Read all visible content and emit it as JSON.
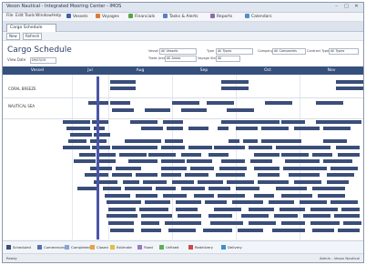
{
  "window": {
    "title": "Veson Nautical - Integrated Mooring Center - IMOS"
  },
  "menu": [
    "File",
    "Edit",
    "Tools",
    "Window",
    "Help"
  ],
  "toolbar": [
    {
      "label": "Vessels",
      "icon": "ship-icon",
      "color": "#3a64a8"
    },
    {
      "label": "Voyages",
      "icon": "route-icon",
      "color": "#e07a2f"
    },
    {
      "label": "Financials",
      "icon": "chart-icon",
      "color": "#58a24b"
    },
    {
      "label": "Tasks & Alerts",
      "icon": "bell-icon",
      "color": "#5a7ec9"
    },
    {
      "label": "Reports",
      "icon": "report-icon",
      "color": "#8d6ab2"
    },
    {
      "label": "Calendars",
      "icon": "calendar-icon",
      "color": "#4f8fcc"
    }
  ],
  "tab": {
    "label": "Cargo Schedule"
  },
  "subbar": {
    "new_label": "New",
    "refresh_label": "Refresh"
  },
  "header": {
    "title": "Cargo Schedule",
    "view_date_label": "View Date",
    "view_date_value": "09/03/19"
  },
  "filters": {
    "vessel_label": "Vessel",
    "vessel_value": "All Vessels",
    "type_label": "Type",
    "type_value": "All Types",
    "company_label": "Company",
    "company_value": "All Companies",
    "contract_type_label": "Contract Type",
    "contract_type_value": "All Types",
    "trade_area_label": "Trade Area",
    "trade_area_value": "All Areas",
    "status_label": "Voyage Status",
    "status_value": "All"
  },
  "grid": {
    "columns": [
      "Vessel",
      "Jul",
      "Aug",
      "Sep",
      "Oct",
      "Nov"
    ],
    "rows": [
      "CORAL BREEZE",
      "NAUTICAL SEA"
    ]
  },
  "legend": [
    {
      "label": "Scheduled",
      "color": "#3b4e7a"
    },
    {
      "label": "Commenced",
      "color": "#5670b5"
    },
    {
      "label": "Completed",
      "color": "#8aa5d6"
    },
    {
      "label": "Closed",
      "color": "#e8a24a"
    },
    {
      "label": "Estimate",
      "color": "#e0c040"
    },
    {
      "label": "Fixed",
      "color": "#9c78c4"
    },
    {
      "label": "Unfixed",
      "color": "#5fae5c"
    },
    {
      "label": "Redelivery",
      "color": "#c84c4c"
    },
    {
      "label": "Delivery",
      "color": "#3f8fc8"
    }
  ],
  "status": {
    "left": "Ready",
    "right": "Admin - Veson Nautical"
  }
}
